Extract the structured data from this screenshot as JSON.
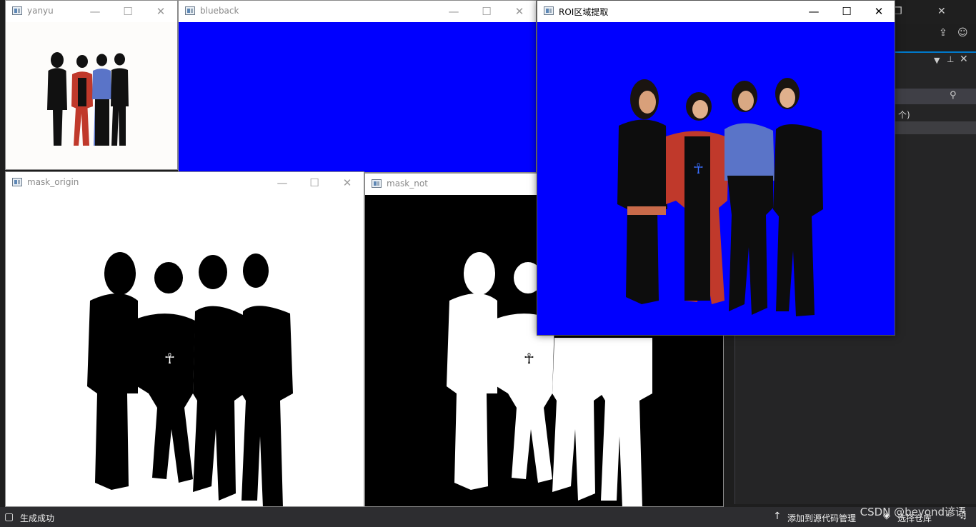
{
  "windows": {
    "yanyu": {
      "title": "yanyu"
    },
    "blueback": {
      "title": "blueback"
    },
    "roi": {
      "title": "ROI区域提取"
    },
    "mask_origin": {
      "title": "mask_origin"
    },
    "mask_not": {
      "title": "mask_not"
    }
  },
  "controls": {
    "minimize": "—",
    "maximize": "☐",
    "close": "✕"
  },
  "vs_panel": {
    "item_fragment": "个)"
  },
  "statusbar": {
    "build_status": "生成成功",
    "add_source_control": "添加到源代码管理",
    "select_repo": "选择仓库"
  },
  "watermark": "CSDN @beyond谚语",
  "colors": {
    "blue_background": "#0000ff",
    "vs_dark": "#1e1e1e",
    "statusbar": "#2d2d30"
  }
}
